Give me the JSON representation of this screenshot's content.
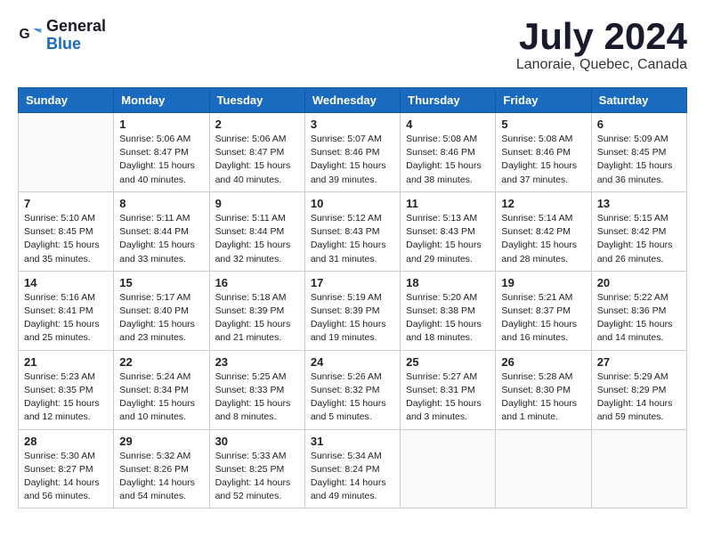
{
  "app": {
    "name_line1": "General",
    "name_line2": "Blue"
  },
  "title": "July 2024",
  "location": "Lanoraie, Quebec, Canada",
  "headers": [
    "Sunday",
    "Monday",
    "Tuesday",
    "Wednesday",
    "Thursday",
    "Friday",
    "Saturday"
  ],
  "weeks": [
    [
      {
        "day": "",
        "info": ""
      },
      {
        "day": "1",
        "info": "Sunrise: 5:06 AM\nSunset: 8:47 PM\nDaylight: 15 hours\nand 40 minutes."
      },
      {
        "day": "2",
        "info": "Sunrise: 5:06 AM\nSunset: 8:47 PM\nDaylight: 15 hours\nand 40 minutes."
      },
      {
        "day": "3",
        "info": "Sunrise: 5:07 AM\nSunset: 8:46 PM\nDaylight: 15 hours\nand 39 minutes."
      },
      {
        "day": "4",
        "info": "Sunrise: 5:08 AM\nSunset: 8:46 PM\nDaylight: 15 hours\nand 38 minutes."
      },
      {
        "day": "5",
        "info": "Sunrise: 5:08 AM\nSunset: 8:46 PM\nDaylight: 15 hours\nand 37 minutes."
      },
      {
        "day": "6",
        "info": "Sunrise: 5:09 AM\nSunset: 8:45 PM\nDaylight: 15 hours\nand 36 minutes."
      }
    ],
    [
      {
        "day": "7",
        "info": "Sunrise: 5:10 AM\nSunset: 8:45 PM\nDaylight: 15 hours\nand 35 minutes."
      },
      {
        "day": "8",
        "info": "Sunrise: 5:11 AM\nSunset: 8:44 PM\nDaylight: 15 hours\nand 33 minutes."
      },
      {
        "day": "9",
        "info": "Sunrise: 5:11 AM\nSunset: 8:44 PM\nDaylight: 15 hours\nand 32 minutes."
      },
      {
        "day": "10",
        "info": "Sunrise: 5:12 AM\nSunset: 8:43 PM\nDaylight: 15 hours\nand 31 minutes."
      },
      {
        "day": "11",
        "info": "Sunrise: 5:13 AM\nSunset: 8:43 PM\nDaylight: 15 hours\nand 29 minutes."
      },
      {
        "day": "12",
        "info": "Sunrise: 5:14 AM\nSunset: 8:42 PM\nDaylight: 15 hours\nand 28 minutes."
      },
      {
        "day": "13",
        "info": "Sunrise: 5:15 AM\nSunset: 8:42 PM\nDaylight: 15 hours\nand 26 minutes."
      }
    ],
    [
      {
        "day": "14",
        "info": "Sunrise: 5:16 AM\nSunset: 8:41 PM\nDaylight: 15 hours\nand 25 minutes."
      },
      {
        "day": "15",
        "info": "Sunrise: 5:17 AM\nSunset: 8:40 PM\nDaylight: 15 hours\nand 23 minutes."
      },
      {
        "day": "16",
        "info": "Sunrise: 5:18 AM\nSunset: 8:39 PM\nDaylight: 15 hours\nand 21 minutes."
      },
      {
        "day": "17",
        "info": "Sunrise: 5:19 AM\nSunset: 8:39 PM\nDaylight: 15 hours\nand 19 minutes."
      },
      {
        "day": "18",
        "info": "Sunrise: 5:20 AM\nSunset: 8:38 PM\nDaylight: 15 hours\nand 18 minutes."
      },
      {
        "day": "19",
        "info": "Sunrise: 5:21 AM\nSunset: 8:37 PM\nDaylight: 15 hours\nand 16 minutes."
      },
      {
        "day": "20",
        "info": "Sunrise: 5:22 AM\nSunset: 8:36 PM\nDaylight: 15 hours\nand 14 minutes."
      }
    ],
    [
      {
        "day": "21",
        "info": "Sunrise: 5:23 AM\nSunset: 8:35 PM\nDaylight: 15 hours\nand 12 minutes."
      },
      {
        "day": "22",
        "info": "Sunrise: 5:24 AM\nSunset: 8:34 PM\nDaylight: 15 hours\nand 10 minutes."
      },
      {
        "day": "23",
        "info": "Sunrise: 5:25 AM\nSunset: 8:33 PM\nDaylight: 15 hours\nand 8 minutes."
      },
      {
        "day": "24",
        "info": "Sunrise: 5:26 AM\nSunset: 8:32 PM\nDaylight: 15 hours\nand 5 minutes."
      },
      {
        "day": "25",
        "info": "Sunrise: 5:27 AM\nSunset: 8:31 PM\nDaylight: 15 hours\nand 3 minutes."
      },
      {
        "day": "26",
        "info": "Sunrise: 5:28 AM\nSunset: 8:30 PM\nDaylight: 15 hours\nand 1 minute."
      },
      {
        "day": "27",
        "info": "Sunrise: 5:29 AM\nSunset: 8:29 PM\nDaylight: 14 hours\nand 59 minutes."
      }
    ],
    [
      {
        "day": "28",
        "info": "Sunrise: 5:30 AM\nSunset: 8:27 PM\nDaylight: 14 hours\nand 56 minutes."
      },
      {
        "day": "29",
        "info": "Sunrise: 5:32 AM\nSunset: 8:26 PM\nDaylight: 14 hours\nand 54 minutes."
      },
      {
        "day": "30",
        "info": "Sunrise: 5:33 AM\nSunset: 8:25 PM\nDaylight: 14 hours\nand 52 minutes."
      },
      {
        "day": "31",
        "info": "Sunrise: 5:34 AM\nSunset: 8:24 PM\nDaylight: 14 hours\nand 49 minutes."
      },
      {
        "day": "",
        "info": ""
      },
      {
        "day": "",
        "info": ""
      },
      {
        "day": "",
        "info": ""
      }
    ]
  ]
}
